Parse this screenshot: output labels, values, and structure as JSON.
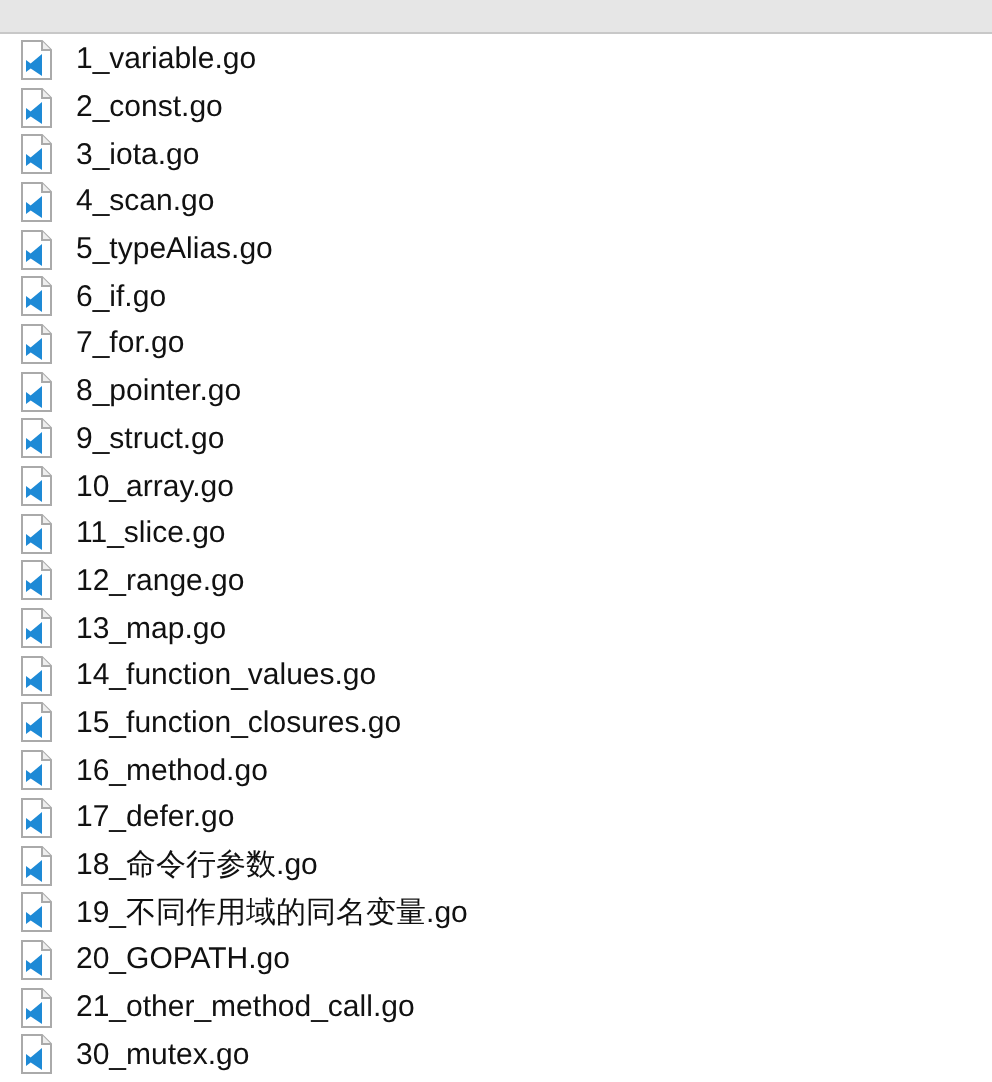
{
  "files": [
    {
      "name": "1_variable.go"
    },
    {
      "name": "2_const.go"
    },
    {
      "name": "3_iota.go"
    },
    {
      "name": "4_scan.go"
    },
    {
      "name": "5_typeAlias.go"
    },
    {
      "name": "6_if.go"
    },
    {
      "name": "7_for.go"
    },
    {
      "name": "8_pointer.go"
    },
    {
      "name": "9_struct.go"
    },
    {
      "name": "10_array.go"
    },
    {
      "name": "11_slice.go"
    },
    {
      "name": "12_range.go"
    },
    {
      "name": "13_map.go"
    },
    {
      "name": "14_function_values.go"
    },
    {
      "name": "15_function_closures.go"
    },
    {
      "name": "16_method.go"
    },
    {
      "name": "17_defer.go"
    },
    {
      "name": "18_命令行参数.go"
    },
    {
      "name": "19_不同作用域的同名变量.go"
    },
    {
      "name": "20_GOPATH.go"
    },
    {
      "name": "21_other_method_call.go"
    },
    {
      "name": "30_mutex.go"
    }
  ]
}
